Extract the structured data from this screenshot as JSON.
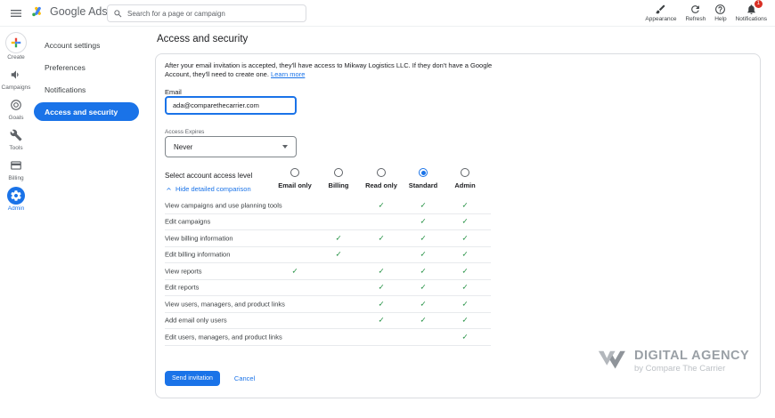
{
  "topbar": {
    "brand": "Google Ads",
    "search": {
      "placeholder": "Search for a page or campaign"
    },
    "actions": [
      {
        "label": "Appearance",
        "icon": "appearance-icon"
      },
      {
        "label": "Refresh",
        "icon": "refresh-icon"
      },
      {
        "label": "Help",
        "icon": "help-icon"
      },
      {
        "label": "Notifications",
        "icon": "notifications-bell-icon",
        "badge": "1"
      }
    ]
  },
  "left_rail": {
    "items": [
      {
        "label": "Create",
        "icon": "create-plus-icon",
        "selected": false
      },
      {
        "label": "Campaigns",
        "icon": "campaigns-icon",
        "selected": false
      },
      {
        "label": "Goals",
        "icon": "goals-icon",
        "selected": false
      },
      {
        "label": "Tools",
        "icon": "tools-icon",
        "selected": false
      },
      {
        "label": "Billing",
        "icon": "billing-icon",
        "selected": false
      },
      {
        "label": "Admin",
        "icon": "admin-gear-icon",
        "selected": true
      }
    ]
  },
  "sidebar": {
    "items": [
      {
        "label": "Account settings",
        "selected": false
      },
      {
        "label": "Preferences",
        "selected": false
      },
      {
        "label": "Notifications",
        "selected": false
      },
      {
        "label": "Access and security",
        "selected": true
      }
    ]
  },
  "page": {
    "title": "Access and security",
    "intro": "After your email invitation is accepted, they'll have access to Mikway Logistics LLC. If they don't have a Google Account, they'll need to create one.",
    "learn_more_label": "Learn more",
    "email": {
      "label": "Email",
      "value": "ada@comparethecarrier.com"
    },
    "access_expires": {
      "label": "Access Expires",
      "value": "Never"
    },
    "access_level": {
      "label": "Select account access level",
      "selected": "Standard",
      "columns": [
        "Email only",
        "Billing",
        "Read only",
        "Standard",
        "Admin"
      ],
      "hide_comparison_label": "Hide detailed comparison"
    },
    "permissions": [
      {
        "label": "View campaigns and use planning tools",
        "access": [
          false,
          false,
          true,
          true,
          true
        ]
      },
      {
        "label": "Edit campaigns",
        "access": [
          false,
          false,
          false,
          true,
          true
        ]
      },
      {
        "label": "View billing information",
        "access": [
          false,
          true,
          true,
          true,
          true
        ]
      },
      {
        "label": "Edit billing information",
        "access": [
          false,
          true,
          false,
          true,
          true
        ]
      },
      {
        "label": "View reports",
        "access": [
          true,
          false,
          true,
          true,
          true
        ]
      },
      {
        "label": "Edit reports",
        "access": [
          false,
          false,
          true,
          true,
          true
        ]
      },
      {
        "label": "View users, managers, and product links",
        "access": [
          false,
          false,
          true,
          true,
          true
        ]
      },
      {
        "label": "Add email only users",
        "access": [
          false,
          false,
          true,
          true,
          true
        ]
      },
      {
        "label": "Edit users, managers, and product links",
        "access": [
          false,
          false,
          false,
          false,
          true
        ]
      }
    ],
    "buttons": {
      "send": "Send invitation",
      "cancel": "Cancel"
    }
  },
  "watermark": {
    "title": "DIGITAL AGENCY",
    "subtitle": "by Compare The Carrier"
  },
  "ui": {
    "check_glyph": "✓",
    "colors": {
      "accent": "#1a73e8",
      "check": "#1e8e3e",
      "badge": "#d93025"
    }
  }
}
